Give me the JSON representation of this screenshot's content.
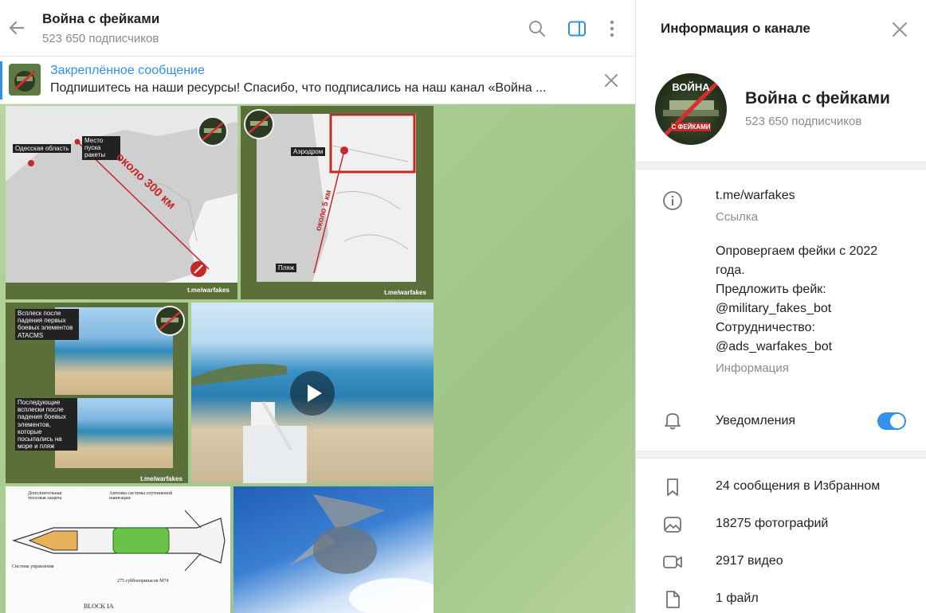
{
  "chat": {
    "title": "Война с фейками",
    "subscribers": "523 650 подписчиков",
    "pinned": {
      "title": "Закреплённое сообщение",
      "text": "Подпишитесь на наши ресурсы!  Спасибо, что подписались на наш канал «Война ..."
    },
    "media": {
      "map1": {
        "label_region": "Одесская область",
        "label_launch": "Место пуска ракеты",
        "distance": "около 300 км",
        "footer": "t.me/warfakes"
      },
      "map2": {
        "label_airfield": "Аэродром",
        "label_beach": "Пляж",
        "distance": "около 5 км",
        "footer": "t.me/warfakes"
      },
      "beach_collage": {
        "caption1": "Всплеск после падения первых боевых элементов ATACMS",
        "caption2": "Последующие всплески после падения боевых элементов, которые посыпались на море и пляж",
        "footer": "t.me/warfakes"
      },
      "video": {
        "play_icon": "play-icon"
      },
      "diagram": {
        "label_protection": "Дополнительная тепловая защита",
        "label_antenna": "Антенна системы спутниковой навигации",
        "label_control": "Система управления",
        "label_submunitions": "275 суббоеприпасов M74",
        "label_block": "BLOCK IA"
      },
      "logo_text_top": "ВОЙНА",
      "logo_text_bottom": "С ФЕЙКАМИ"
    }
  },
  "info": {
    "header": "Информация о канале",
    "name": "Война с фейками",
    "subscribers": "523 650 подписчиков",
    "link": "t.me/warfakes",
    "link_caption": "Ссылка",
    "description": {
      "line1": "Опровергаем фейки с 2022",
      "line2": "года.",
      "line3": "Предложить фейк:",
      "line4": "@military_fakes_bot",
      "line5": "Сотрудничество:",
      "line6": "@ads_warfakes_bot"
    },
    "description_caption": "Информация",
    "notifications": "Уведомления",
    "notifications_on": true,
    "saved": "24 сообщения в Избранном",
    "photos": "18275 фотографий",
    "videos": "2917 видео",
    "files": "1 файл"
  },
  "colors": {
    "accent": "#3390ec",
    "chat_bg": "#a8cc92",
    "brand_red": "#d32f2f"
  }
}
